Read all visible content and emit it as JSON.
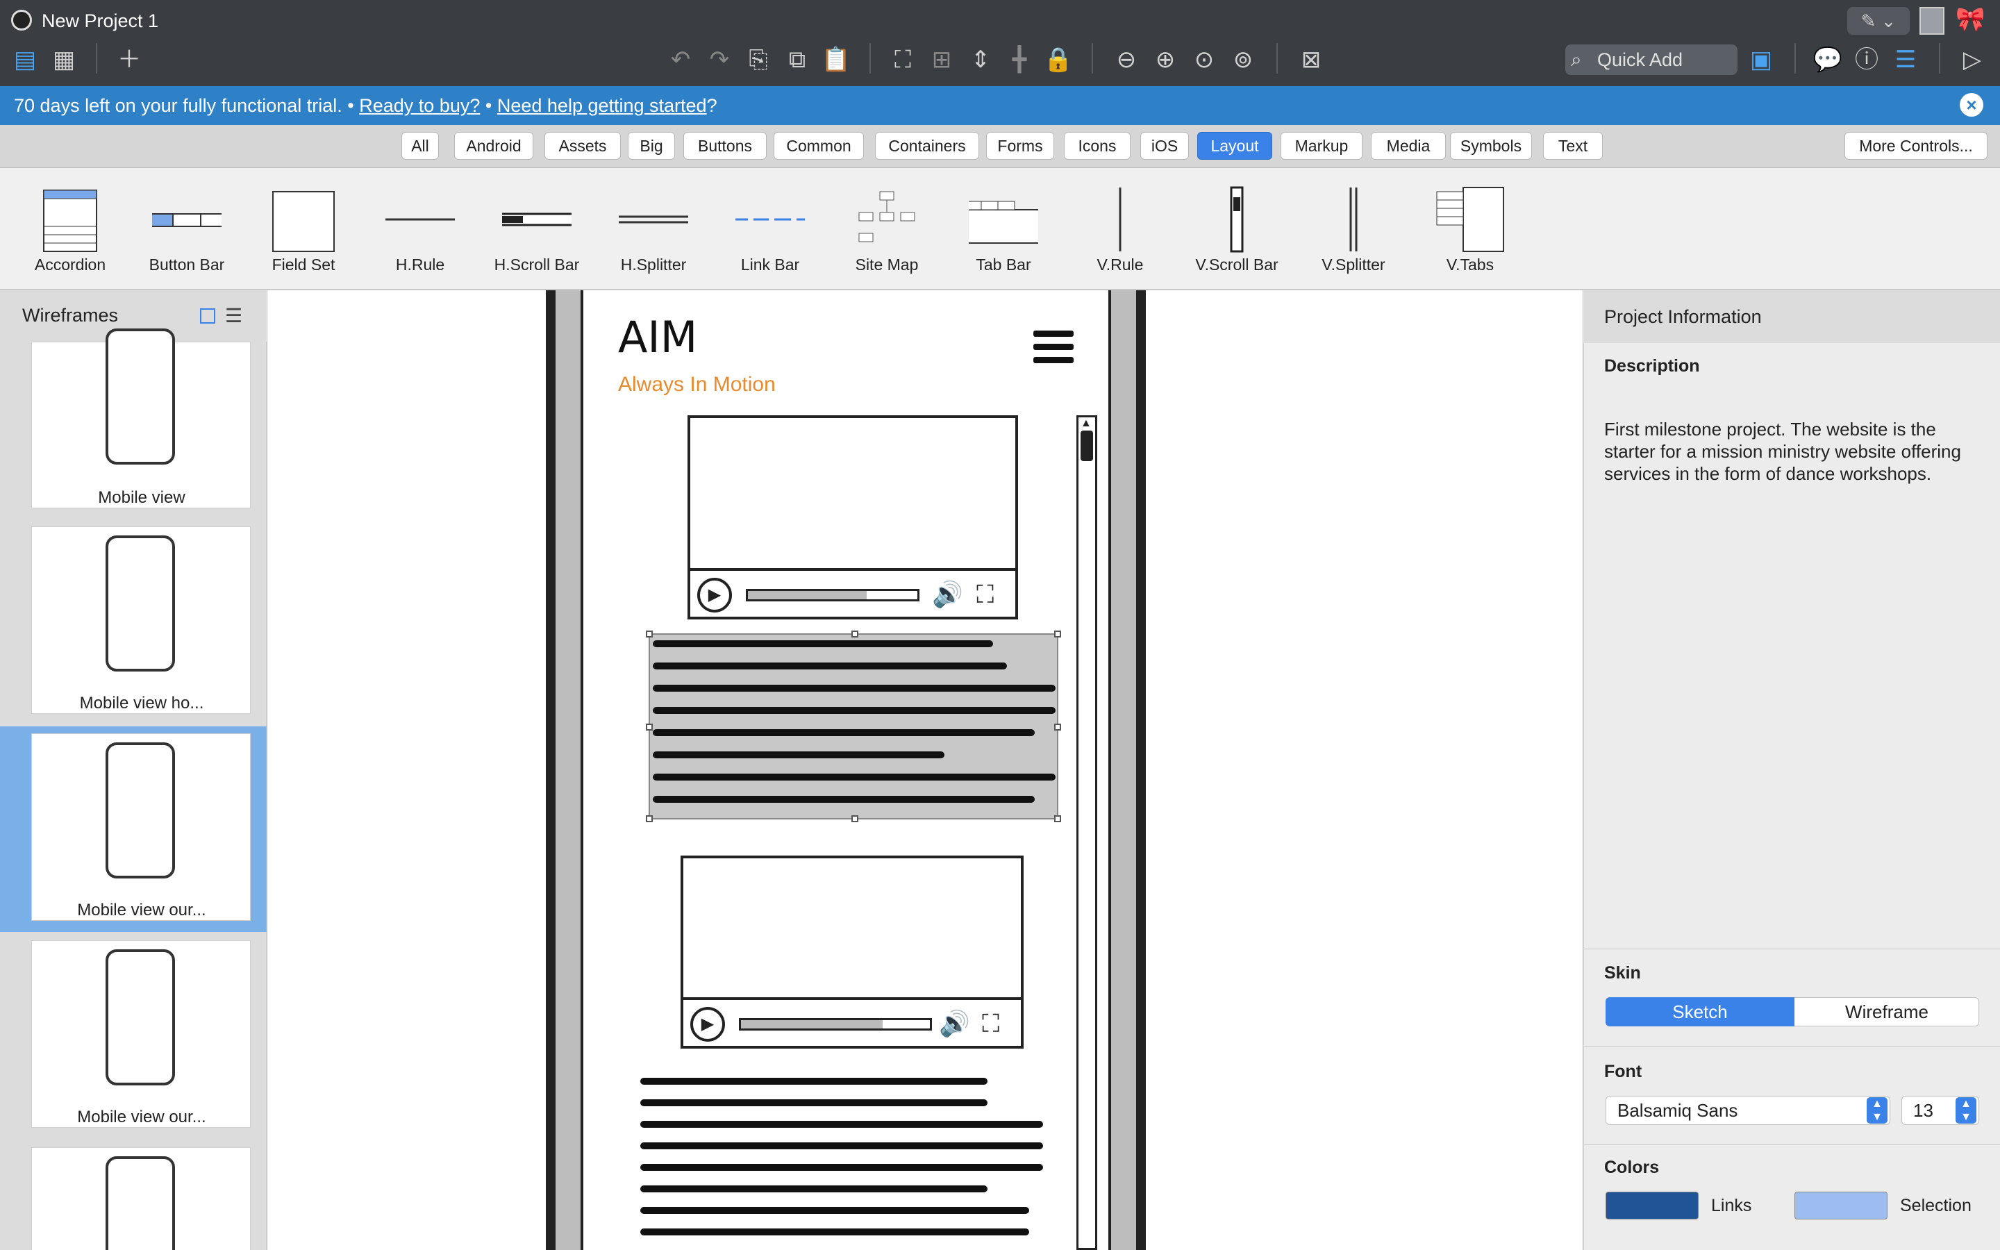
{
  "app": {
    "title": "New Project 1"
  },
  "toolbar": {
    "quick_add_placeholder": "Quick Add"
  },
  "trial": {
    "message": "70 days left on your fully functional trial.",
    "sep": "•",
    "buy_link": "Ready to buy?",
    "help_link": "Need help getting started",
    "help_suffix": "?"
  },
  "categories": [
    "All",
    "Android",
    "Assets",
    "Big",
    "Buttons",
    "Common",
    "Containers",
    "Forms",
    "Icons",
    "iOS",
    "Layout",
    "Markup",
    "Media",
    "Symbols",
    "Text"
  ],
  "active_category": "Layout",
  "more_controls": "More Controls...",
  "library": [
    "Accordion",
    "Button Bar",
    "Field Set",
    "H.Rule",
    "H.Scroll Bar",
    "H.Splitter",
    "Link Bar",
    "Site Map",
    "Tab Bar",
    "V.Rule",
    "V.Scroll Bar",
    "V.Splitter",
    "V.Tabs"
  ],
  "wireframes": {
    "title": "Wireframes",
    "items": [
      "Mobile view",
      "Mobile view ho...",
      "Mobile view our...",
      "Mobile view our..."
    ]
  },
  "mockup": {
    "logo": "AIM",
    "tagline": "Always In Motion",
    "video1_progress": 0.7,
    "video2_progress": 0.75
  },
  "project_info": {
    "title": "Project Information",
    "description_label": "Description",
    "description": "First milestone project. The website is the starter for a mission ministry website offering services in the form of dance workshops.",
    "skin_label": "Skin",
    "skin_options": [
      "Sketch",
      "Wireframe"
    ],
    "skin_selected": "Sketch",
    "font_label": "Font",
    "font_value": "Balsamiq Sans",
    "font_size": "13",
    "colors_label": "Colors",
    "links_label": "Links",
    "selection_label": "Selection",
    "links_color": "#1f5496",
    "selection_color": "#9dbdf0"
  }
}
